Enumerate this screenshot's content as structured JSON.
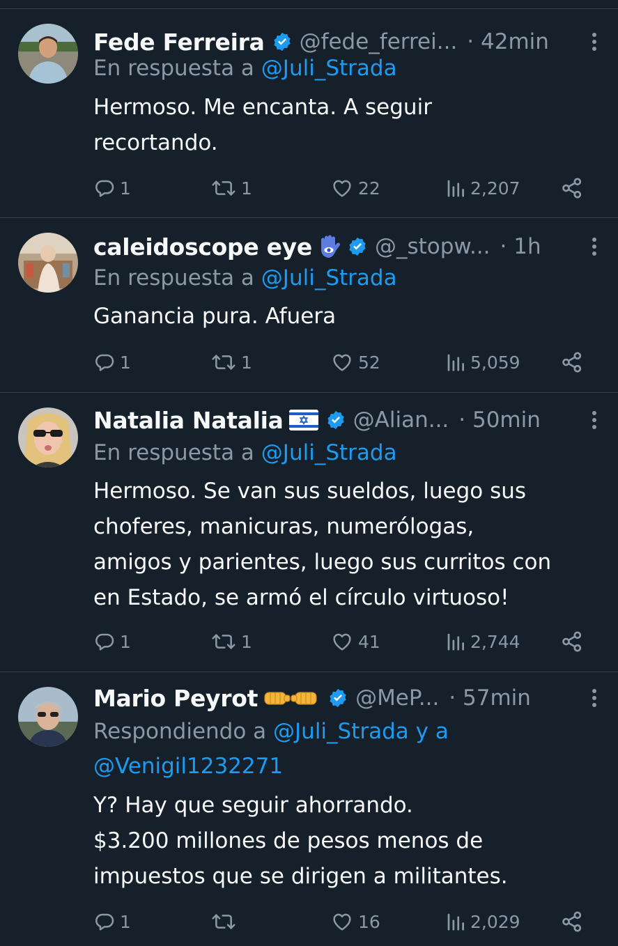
{
  "colors": {
    "background": "#15202b",
    "text": "#f7f9f9",
    "muted": "#8b98a5",
    "link": "#1d9bf0",
    "divider": "#38444d",
    "verified": "#1d9bf0"
  },
  "tweets": [
    {
      "name": "Fede Ferreira",
      "flair": "",
      "handle": "@fede_ferrei...",
      "time": "· 42min",
      "reply_prefix": "En respuesta a",
      "reply_to": "@Juli_Strada",
      "reply_to_2": "",
      "lines": [
        "Hermoso. Me encanta. A seguir",
        "recortando."
      ],
      "replies": "1",
      "retweets": "1",
      "likes": "22",
      "views": "2,207"
    },
    {
      "name": "caleidoscope eye",
      "flair": "hamsa-hand-icon",
      "handle": "@_stopw...",
      "time": "· 1h",
      "reply_prefix": "En respuesta a",
      "reply_to": "@Juli_Strada",
      "reply_to_2": "",
      "lines": [
        "Ganancia pura. Afuera"
      ],
      "replies": "1",
      "retweets": "1",
      "likes": "52",
      "views": "5,059"
    },
    {
      "name": "Natalia Natalia",
      "flair": "israel-flag-icon",
      "handle": "@Alian...",
      "time": "· 50min",
      "reply_prefix": "En respuesta a",
      "reply_to": "@Juli_Strada",
      "reply_to_2": "",
      "lines": [
        "Hermoso. Se van sus sueldos, luego sus",
        "choferes, manicuras, numerólogas,",
        "amigos y parientes, luego sus curritos con",
        "en Estado, se armó el círculo virtuoso!"
      ],
      "replies": "1",
      "retweets": "1",
      "likes": "41",
      "views": "2,744"
    },
    {
      "name": "Mario Peyrot",
      "flair": "fist-bump-icons",
      "handle": "@MeP...",
      "time": "· 57min",
      "reply_prefix": "Respondiendo a",
      "reply_to": "@Juli_Strada y a",
      "reply_to_2": "@Venigil1232271",
      "lines": [
        "Y? Hay que seguir ahorrando.",
        "$3.200 millones de pesos menos de",
        "impuestos que se dirigen a militantes."
      ],
      "replies": "1",
      "retweets": "",
      "likes": "16",
      "views": "2,029"
    }
  ]
}
